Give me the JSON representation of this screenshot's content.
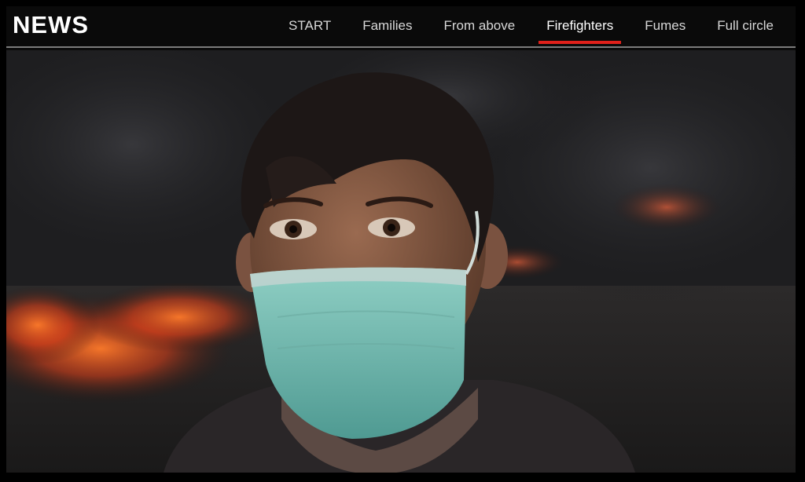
{
  "header": {
    "brand": "NEWS",
    "nav": [
      {
        "label": "START",
        "active": false
      },
      {
        "label": "Families",
        "active": false
      },
      {
        "label": "From above",
        "active": false
      },
      {
        "label": "Firefighters",
        "active": true
      },
      {
        "label": "Fumes",
        "active": false
      },
      {
        "label": "Full circle",
        "active": false
      }
    ]
  },
  "colors": {
    "accent_underline": "#e0201a",
    "bar_background": "#0a0a0a",
    "rule": "#7b7b7b"
  },
  "photo": {
    "subject": "boy-wearing-green-surgical-mask-in-smoke-and-fire"
  }
}
